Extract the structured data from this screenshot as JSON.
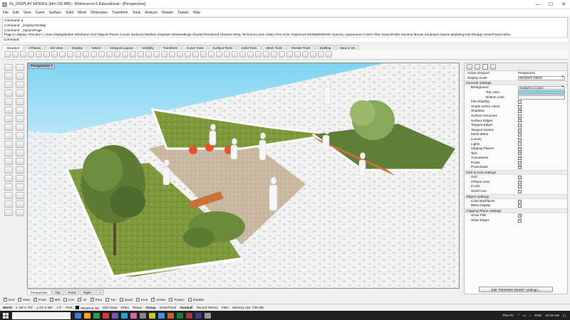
{
  "window": {
    "title": "01_DISPLAY MODES.3dm (32 MB) - Rhinoceros 6 Educational - [Perspective]",
    "controls": [
      "—",
      "☐",
      "✕"
    ]
  },
  "menu": [
    "File",
    "Edit",
    "View",
    "Curve",
    "Surface",
    "Solid",
    "Mesh",
    "Dimension",
    "Transform",
    "Tools",
    "Analyze",
    "Render",
    "Panels",
    "Help"
  ],
  "command_history": [
    "Command: q",
    "Command: _DisplayAttrsMgr",
    "Command: _OptionsPage",
    "Page to display <Render> ( View DisplayModes Wireframe Grid Objects Points Curves Surfaces Meshes Shadows OtherSettings Shaded Rendered Ghosted XRay Technical Lines Artistic Pen Arctic Raytraced RENDERDEMO OpenGL Appearance Colors Files SearchPaths General Mouse Keyboard Aliases ModelingAids Rhudge SmartTrackAndGu"
  ],
  "command_prompt": "Command:",
  "toolbar_tabs": [
    "Standard",
    "CPlanes",
    "Set View",
    "Display",
    "Select",
    "Viewport Layout",
    "Visibility",
    "Transform",
    "Curve Tools",
    "Surface Tools",
    "Solid Tools",
    "Mesh Tools",
    "Render Tools",
    "Drafting",
    "New in V6"
  ],
  "active_toolbar_tab": "Standard",
  "viewport": {
    "label": "Perspective ▾"
  },
  "viewport_tabs": [
    "Perspective",
    "Top",
    "Front",
    "Right",
    "+"
  ],
  "osnaps": [
    {
      "label": "End",
      "checked": true
    },
    {
      "label": "Near",
      "checked": true
    },
    {
      "label": "Point",
      "checked": true
    },
    {
      "label": "Mid",
      "checked": true
    },
    {
      "label": "Cen",
      "checked": false
    },
    {
      "label": "Int",
      "checked": true
    },
    {
      "label": "Perp",
      "checked": true
    },
    {
      "label": "Tan",
      "checked": false
    },
    {
      "label": "Quad",
      "checked": false
    },
    {
      "label": "Knot",
      "checked": false
    },
    {
      "label": "Vertex",
      "checked": true
    },
    {
      "label": "Project",
      "checked": false
    },
    {
      "label": "Disable",
      "checked": false
    }
  ],
  "status": {
    "cplane": "World",
    "x": "x -30'-1 7/8\"",
    "y": "y 24'-3 3/8\"",
    "z": "z 0\"",
    "units": "Feet",
    "layer": "PEOPLE 3D",
    "toggles": [
      "Grid Snap",
      "Ortho",
      "Planar",
      "Osnap",
      "SmartTrack",
      "Gumball",
      "Record History",
      "Filter"
    ],
    "memory": "Memory use: 745 MB"
  },
  "panel": {
    "rows_top": [
      {
        "label": "Active viewport",
        "value": "Perspective"
      },
      {
        "label": "Display mode",
        "value": "RENDER DEMO"
      }
    ],
    "sections": [
      {
        "title": "General settings",
        "rows": [
          {
            "label": "Background",
            "kind": "dropdown",
            "value": "Gradient 2 Colors"
          },
          {
            "label": "Top color:",
            "kind": "color",
            "indent": 2
          },
          {
            "label": "Bottom color:",
            "kind": "color",
            "indent": 2
          },
          {
            "label": "Flat Shading",
            "kind": "check",
            "checked": false
          },
          {
            "label": "Shade vertex colors",
            "kind": "check",
            "checked": false
          },
          {
            "label": "Shadows",
            "kind": "check",
            "checked": true
          },
          {
            "label": "Surface Isocurves",
            "kind": "check",
            "checked": false
          },
          {
            "label": "Surface Edges",
            "kind": "check",
            "checked": false
          },
          {
            "label": "Tangent Edges",
            "kind": "check",
            "checked": false
          },
          {
            "label": "Tangent Seams",
            "kind": "check",
            "checked": true
          },
          {
            "label": "Mesh Wires",
            "kind": "check",
            "checked": false
          },
          {
            "label": "Curves",
            "kind": "check",
            "checked": false
          },
          {
            "label": "Lights",
            "kind": "check",
            "checked": false
          },
          {
            "label": "Clipping Planes",
            "kind": "check",
            "checked": true
          },
          {
            "label": "Text",
            "kind": "check",
            "checked": true
          },
          {
            "label": "Annotations",
            "kind": "check",
            "checked": true
          },
          {
            "label": "Points",
            "kind": "check",
            "checked": true
          },
          {
            "label": "Pointclouds",
            "kind": "check",
            "checked": true
          }
        ]
      },
      {
        "title": "Grid & Axis settings",
        "rows": [
          {
            "label": "Grid",
            "kind": "check",
            "checked": false
          },
          {
            "label": "CPlane Axes",
            "kind": "check",
            "checked": false
          },
          {
            "label": "Z Axis",
            "kind": "check",
            "checked": false
          },
          {
            "label": "World Icon",
            "kind": "check",
            "checked": false
          }
        ]
      },
      {
        "title": "Object settings",
        "rows": [
          {
            "label": "Color Backfaces",
            "kind": "check",
            "checked": false
          },
          {
            "label": "BBox Display",
            "kind": "check",
            "checked": false
          }
        ]
      },
      {
        "title": "Clipping Plane settings",
        "rows": [
          {
            "label": "Show Fills",
            "kind": "check",
            "checked": true
          },
          {
            "label": "Show Edges",
            "kind": "check",
            "checked": true
          }
        ]
      }
    ],
    "edit_button": "Edit \"RENDER DEMO\" settings...",
    "colors": {
      "top": "#7fd4f2",
      "bottom": "#ffffff"
    }
  },
  "taskbar": {
    "search_placeholder": "",
    "tray_items": [
      "This PC",
      "ENG",
      "10:18 AM"
    ]
  }
}
